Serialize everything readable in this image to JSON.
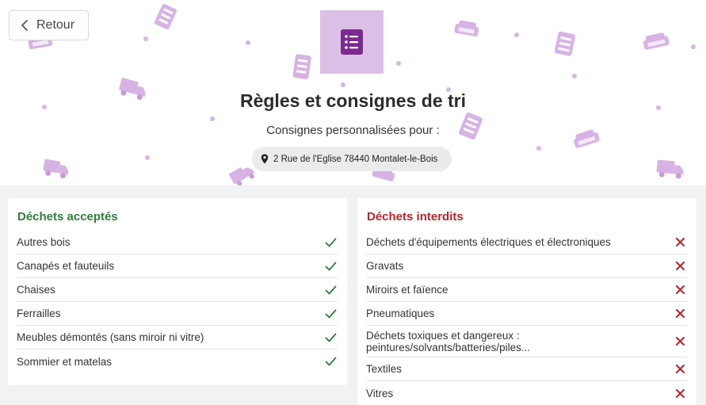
{
  "header": {
    "back_label": "Retour",
    "title": "Règles et consignes de tri",
    "subtitle": "Consignes personnalisées pour :",
    "address": "2 Rue de l'Eglise 78440 Montalet-le-Bois"
  },
  "accepted": {
    "heading": "Déchets acceptés",
    "items": [
      "Autres bois",
      "Canapés et fauteuils",
      "Chaises",
      "Ferrailles",
      "Meubles démontés (sans miroir ni vitre)",
      "Sommier et matelas"
    ]
  },
  "forbidden": {
    "heading": "Déchets interdits",
    "items": [
      "Déchets d'équipements électriques et électroniques",
      "Gravats",
      "Miroirs et faïence",
      "Pneumatiques",
      "Déchets toxiques et dangereux : peintures/solvants/batteries/piles...",
      "Textiles",
      "Vitres"
    ]
  },
  "colors": {
    "accent_purple": "#7b2a8f",
    "tile_purple": "#dcbfe6",
    "decor_purple": "#cfa9dc",
    "accepted_green": "#2e7d3e",
    "forbidden_red": "#b3262d"
  },
  "icons": {
    "back": "chevron-left-icon",
    "logo": "checklist-icon",
    "address": "map-pin-icon",
    "accepted_mark": "check-icon",
    "forbidden_mark": "cross-icon"
  }
}
